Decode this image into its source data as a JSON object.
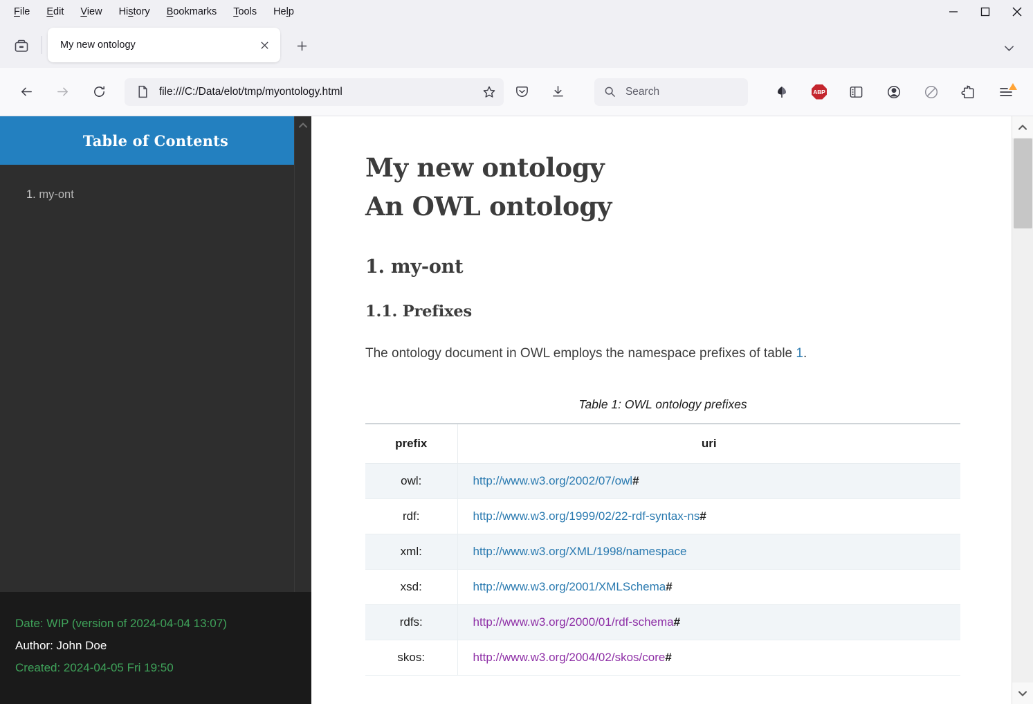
{
  "browser": {
    "menubar": [
      {
        "pre": "",
        "accel": "F",
        "post": "ile",
        "name": "menu-file"
      },
      {
        "pre": "",
        "accel": "E",
        "post": "dit",
        "name": "menu-edit"
      },
      {
        "pre": "",
        "accel": "V",
        "post": "iew",
        "name": "menu-view"
      },
      {
        "pre": "Hi",
        "accel": "s",
        "post": "tory",
        "name": "menu-history"
      },
      {
        "pre": "",
        "accel": "B",
        "post": "ookmarks",
        "name": "menu-bookmarks"
      },
      {
        "pre": "",
        "accel": "T",
        "post": "ools",
        "name": "menu-tools"
      },
      {
        "pre": "He",
        "accel": "l",
        "post": "p",
        "name": "menu-help"
      }
    ],
    "window_controls": {
      "minimize": "minimize-icon",
      "maximize": "maximize-icon",
      "close": "close-icon",
      "tablist": "chevron-down-icon"
    },
    "tab": {
      "title": "My new ontology",
      "close_label": "close-tab-icon",
      "newtab_label": "new-tab-icon",
      "firefoxview_label": "firefox-view-icon"
    },
    "nav": {
      "back": "back-arrow-icon",
      "forward": "forward-arrow-icon",
      "reload": "reload-icon"
    },
    "url": {
      "value": "file:///C:/Data/elot/tmp/myontology.html",
      "page_icon": "document-icon",
      "bookmark_icon": "star-icon"
    },
    "search": {
      "placeholder": "Search",
      "icon": "search-icon"
    },
    "toolbar_icons": [
      {
        "name": "pocket-icon",
        "label": "Save to Pocket"
      },
      {
        "name": "downloads-icon",
        "label": "Downloads"
      },
      {
        "name": "zotero-connector-icon",
        "label": "Zotero Connector"
      },
      {
        "name": "adblock-plus-icon",
        "label": "ABP"
      },
      {
        "name": "sidebar-toggle-icon",
        "label": "Sidebars"
      },
      {
        "name": "account-icon",
        "label": "Account"
      },
      {
        "name": "noscript-icon",
        "label": "NoScript"
      },
      {
        "name": "extensions-icon",
        "label": "Extensions"
      },
      {
        "name": "app-menu-icon",
        "label": "Open application menu"
      }
    ]
  },
  "page": {
    "toc": {
      "header": "Table of Contents",
      "items": [
        {
          "number": "1.",
          "label": "my-ont"
        }
      ]
    },
    "footer": {
      "date": "Date: WIP (version of 2024-04-04 13:07)",
      "author": "Author: John Doe",
      "created": "Created: 2024-04-05 Fri 19:50"
    },
    "doc": {
      "title": "My new ontology",
      "subtitle": "An OWL ontology",
      "section_heading": "1. my-ont",
      "subsection_heading": "1.1. Prefixes",
      "paragraph_before_link": "The ontology document in OWL employs the namespace prefixes of table ",
      "paragraph_link": "1",
      "paragraph_after_link": ".",
      "table": {
        "caption": "Table 1: OWL ontology prefixes",
        "columns": [
          "prefix",
          "uri"
        ],
        "rows": [
          {
            "prefix": "owl:",
            "uri": "http://www.w3.org/2002/07/owl",
            "hash": "#",
            "visited": false
          },
          {
            "prefix": "rdf:",
            "uri": "http://www.w3.org/1999/02/22-rdf-syntax-ns",
            "hash": "#",
            "visited": false
          },
          {
            "prefix": "xml:",
            "uri": "http://www.w3.org/XML/1998/namespace",
            "hash": "",
            "visited": false
          },
          {
            "prefix": "xsd:",
            "uri": "http://www.w3.org/2001/XMLSchema",
            "hash": "#",
            "visited": false
          },
          {
            "prefix": "rdfs:",
            "uri": "http://www.w3.org/2000/01/rdf-schema",
            "hash": "#",
            "visited": true
          },
          {
            "prefix": "skos:",
            "uri": "http://www.w3.org/2004/02/skos/core",
            "hash": "#",
            "visited": true
          }
        ]
      }
    }
  },
  "colors": {
    "toc_header_bg": "#2380c0",
    "toc_bg": "#2e2e2e",
    "footer_bg": "#1a1a1a",
    "footer_green": "#3fa35a",
    "link_blue": "#2a7ab0",
    "link_visited": "#8e2fa6",
    "heading": "#3c3c3c",
    "abp_red": "#c4262e",
    "badge_orange": "#ffa436"
  }
}
